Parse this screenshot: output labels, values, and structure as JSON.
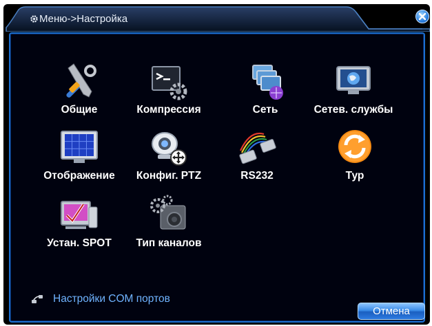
{
  "window": {
    "title": "Меню->Настройка",
    "icons": {
      "title": "gear-icon",
      "close": "close-icon"
    }
  },
  "items": [
    {
      "label": "Общие",
      "icon": "tools-icon"
    },
    {
      "label": "Компрессия",
      "icon": "terminal-gear-icon"
    },
    {
      "label": "Сеть",
      "icon": "network-icon"
    },
    {
      "label": "Сетев. службы",
      "icon": "globe-monitor-icon"
    },
    {
      "label": "Отображение",
      "icon": "display-grid-icon"
    },
    {
      "label": "Конфиг. PTZ",
      "icon": "ptz-camera-icon"
    },
    {
      "label": "RS232",
      "icon": "cable-connector-icon"
    },
    {
      "label": "Тур",
      "icon": "refresh-icon"
    },
    {
      "label": "Устан. SPOT",
      "icon": "spot-monitor-icon"
    },
    {
      "label": "Тип каналов",
      "icon": "camera-channel-icon"
    }
  ],
  "com_settings": {
    "label": "Настройки COM портов",
    "icon": "serial-port-icon"
  },
  "cancel_label": "Отмена",
  "colors": {
    "accent": "#1b6fd0",
    "link": "#6fb3ff",
    "background": "#000000"
  }
}
